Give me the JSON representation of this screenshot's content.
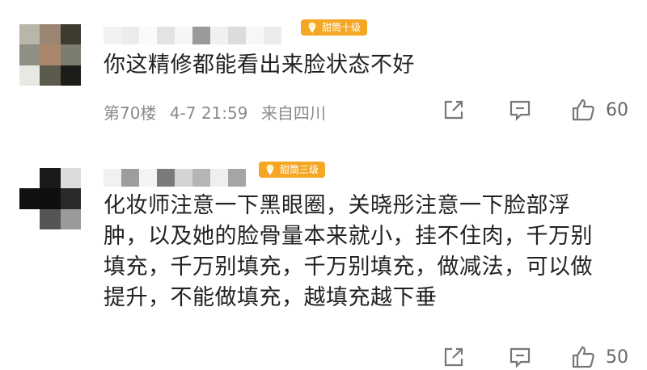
{
  "comments": [
    {
      "badge": "甜筒十级",
      "text": "你这精修都能看出来脸状态不好",
      "floor": "第70楼",
      "time": "4-7 21:59",
      "location": "来自四川",
      "likes": "60",
      "icons": [
        "share-icon",
        "reply-icon",
        "thumbs-up-icon"
      ]
    },
    {
      "badge": "甜筒三级",
      "text_lines": [
        "化妆师注意一下黑眼圈，关晓彤注意一下脸部浮",
        "肿，以及她的脸骨量本来就小，挂不住肉，千万别",
        "填充，千万别填充，千万别填充，做减法，可以做",
        "提升，不能做填充，越填充越下垂"
      ],
      "likes": "50",
      "icons": [
        "share-icon",
        "reply-icon",
        "thumbs-up-icon"
      ]
    }
  ],
  "colors": {
    "badge": "#f5a623",
    "text": "#222222",
    "meta": "#8a8a8a"
  }
}
